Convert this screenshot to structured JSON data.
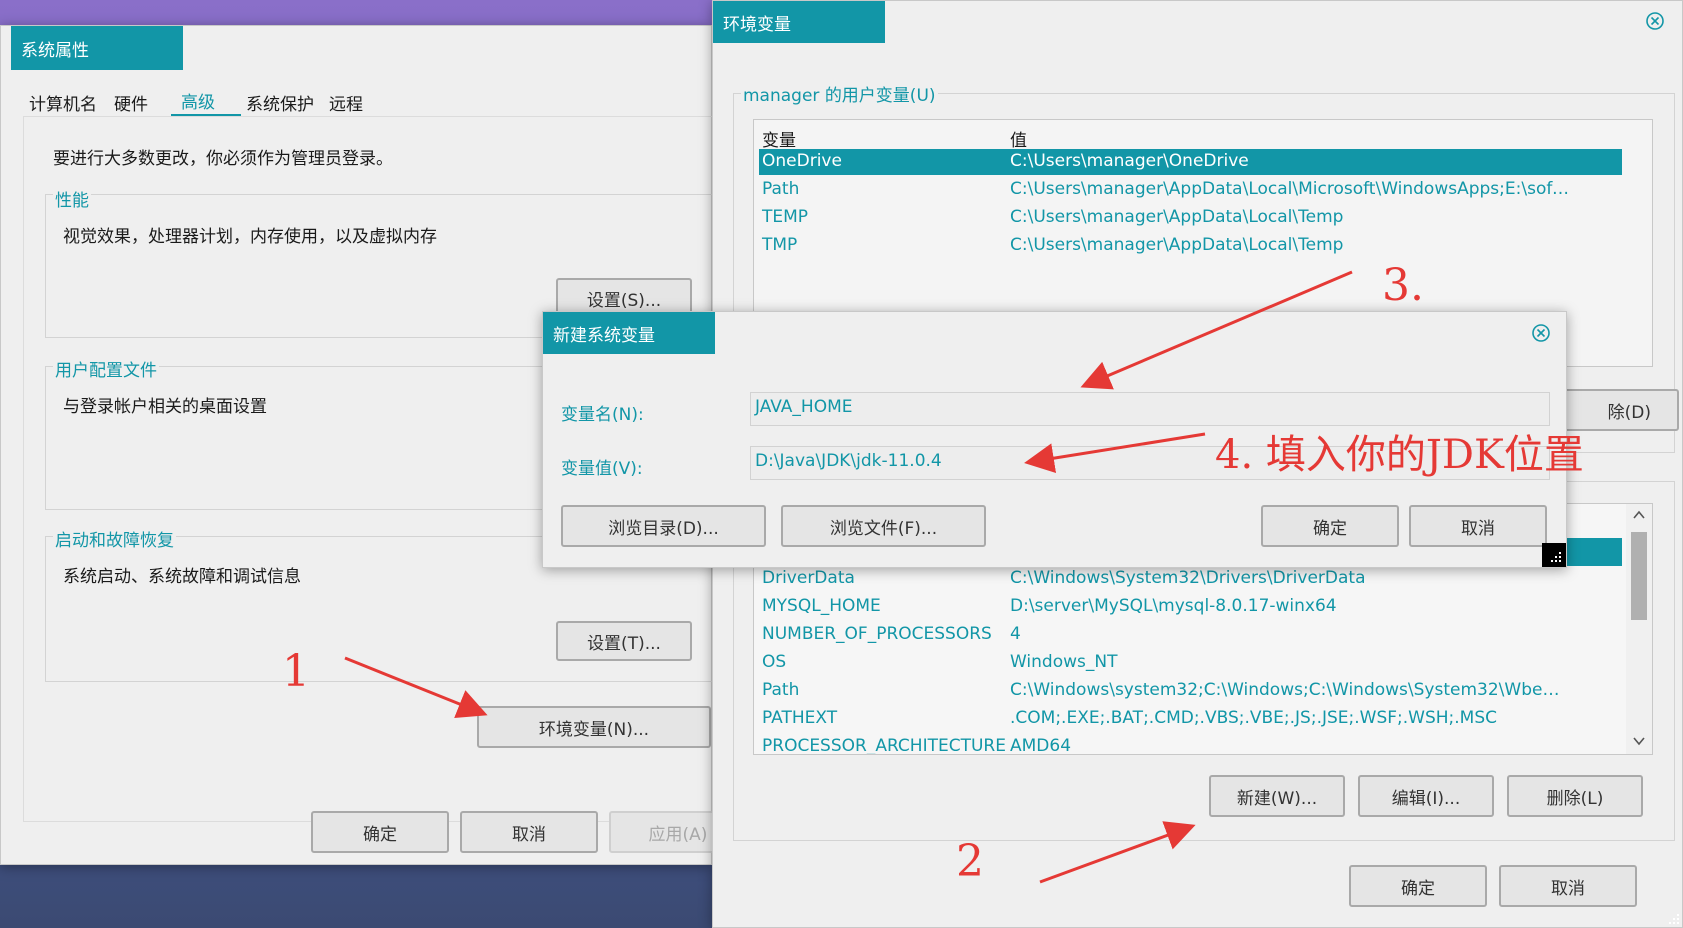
{
  "sys_props": {
    "title": "系统属性",
    "tabs": [
      "计算机名",
      "硬件",
      "高级",
      "系统保护",
      "远程"
    ],
    "admin_note": "要进行大多数更改，你必须作为管理员登录。",
    "perf": {
      "label": "性能",
      "desc": "视觉效果，处理器计划，内存使用，以及虚拟内存",
      "button": "设置(S)..."
    },
    "profile": {
      "label": "用户配置文件",
      "desc": "与登录帐户相关的桌面设置"
    },
    "startup": {
      "label": "启动和故障恢复",
      "desc": "系统启动、系统故障和调试信息",
      "button": "设置(T)..."
    },
    "env_button": "环境变量(N)...",
    "ok": "确定",
    "cancel": "取消",
    "apply": "应用(A)"
  },
  "env": {
    "title": "环境变量",
    "user_group_label": "manager 的用户变量(U)",
    "col_var": "变量",
    "col_val": "值",
    "user_vars": [
      {
        "name": "OneDrive",
        "value": "C:\\Users\\manager\\OneDrive"
      },
      {
        "name": "Path",
        "value": "C:\\Users\\manager\\AppData\\Local\\Microsoft\\WindowsApps;E:\\soft..."
      },
      {
        "name": "TEMP",
        "value": "C:\\Users\\manager\\AppData\\Local\\Temp"
      },
      {
        "name": "TMP",
        "value": "C:\\Users\\manager\\AppData\\Local\\Temp"
      }
    ],
    "user_delete_partial": "除(D)",
    "sys_vars": [
      {
        "name": "DriverData",
        "value": "C:\\Windows\\System32\\Drivers\\DriverData"
      },
      {
        "name": "MYSQL_HOME",
        "value": "D:\\server\\MySQL\\mysql-8.0.17-winx64"
      },
      {
        "name": "NUMBER_OF_PROCESSORS",
        "value": "4"
      },
      {
        "name": "OS",
        "value": "Windows_NT"
      },
      {
        "name": "Path",
        "value": "C:\\Windows\\system32;C:\\Windows;C:\\Windows\\System32\\Wbem;..."
      },
      {
        "name": "PATHEXT",
        "value": ".COM;.EXE;.BAT;.CMD;.VBS;.VBE;.JS;.JSE;.WSF;.WSH;.MSC"
      },
      {
        "name": "PROCESSOR_ARCHITECTURE",
        "value": "AMD64"
      }
    ],
    "new_button": "新建(W)...",
    "edit_button": "编辑(I)...",
    "delete_button": "删除(L)",
    "ok": "确定",
    "cancel": "取消"
  },
  "new_var": {
    "title": "新建系统变量",
    "name_label": "变量名(N):",
    "name_value": "JAVA_HOME",
    "value_label": "变量值(V):",
    "value_value": "D:\\Java\\JDK\\jdk-11.0.4",
    "browse_dir": "浏览目录(D)...",
    "browse_file": "浏览文件(F)...",
    "ok": "确定",
    "cancel": "取消"
  },
  "annotations": {
    "step1": "1",
    "step2": "2",
    "step3": "3.",
    "step4": "4. 填入你的JDK位置"
  },
  "colors": {
    "accent": "#1296a7",
    "annotation": "#e53935"
  }
}
